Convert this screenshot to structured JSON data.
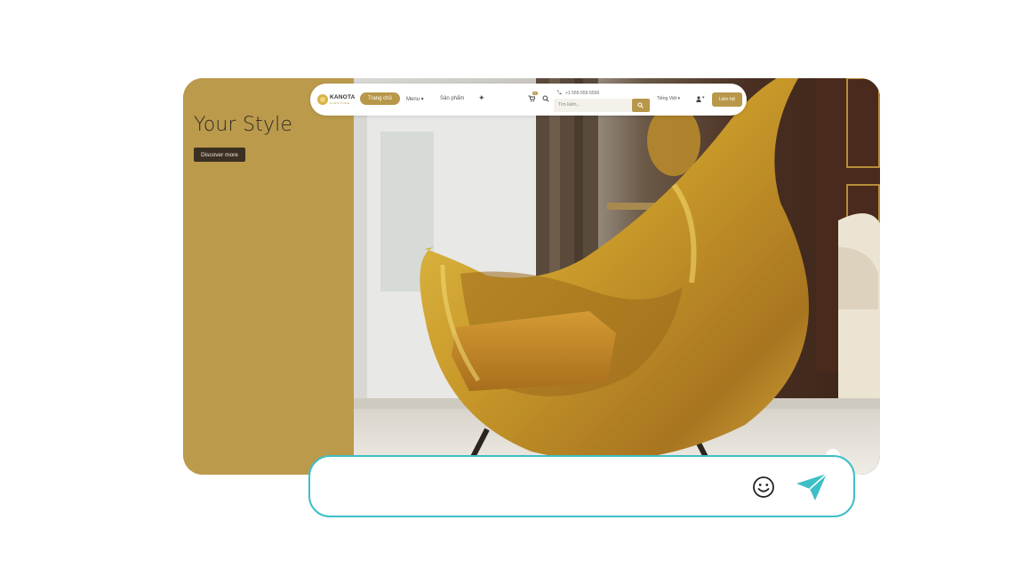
{
  "hero": {
    "title": "Your Style",
    "cta_label": "Discover more",
    "accent_color": "#bb9a4c"
  },
  "nav": {
    "logo_text": "KANOTA",
    "logo_sub": "FURNITURE",
    "items": [
      {
        "label": "Trang chủ",
        "active": true
      },
      {
        "label": "Menu ▾"
      },
      {
        "label": "Sản phẩm"
      }
    ],
    "sparkle_icon": "sparkle-icon",
    "cart_badge": "0",
    "phone": "+1 555-555-5556",
    "search_placeholder": "Tìm kiếm...",
    "language": "Tiếng Việt ▾",
    "user_caret": "▾",
    "contact_label": "Liên hệ",
    "brand_color": "#b8974a"
  },
  "chat": {
    "placeholder": "",
    "emoji_icon": "smiley-icon",
    "send_icon": "paper-plane-icon",
    "border_color": "#3dbfc6"
  }
}
